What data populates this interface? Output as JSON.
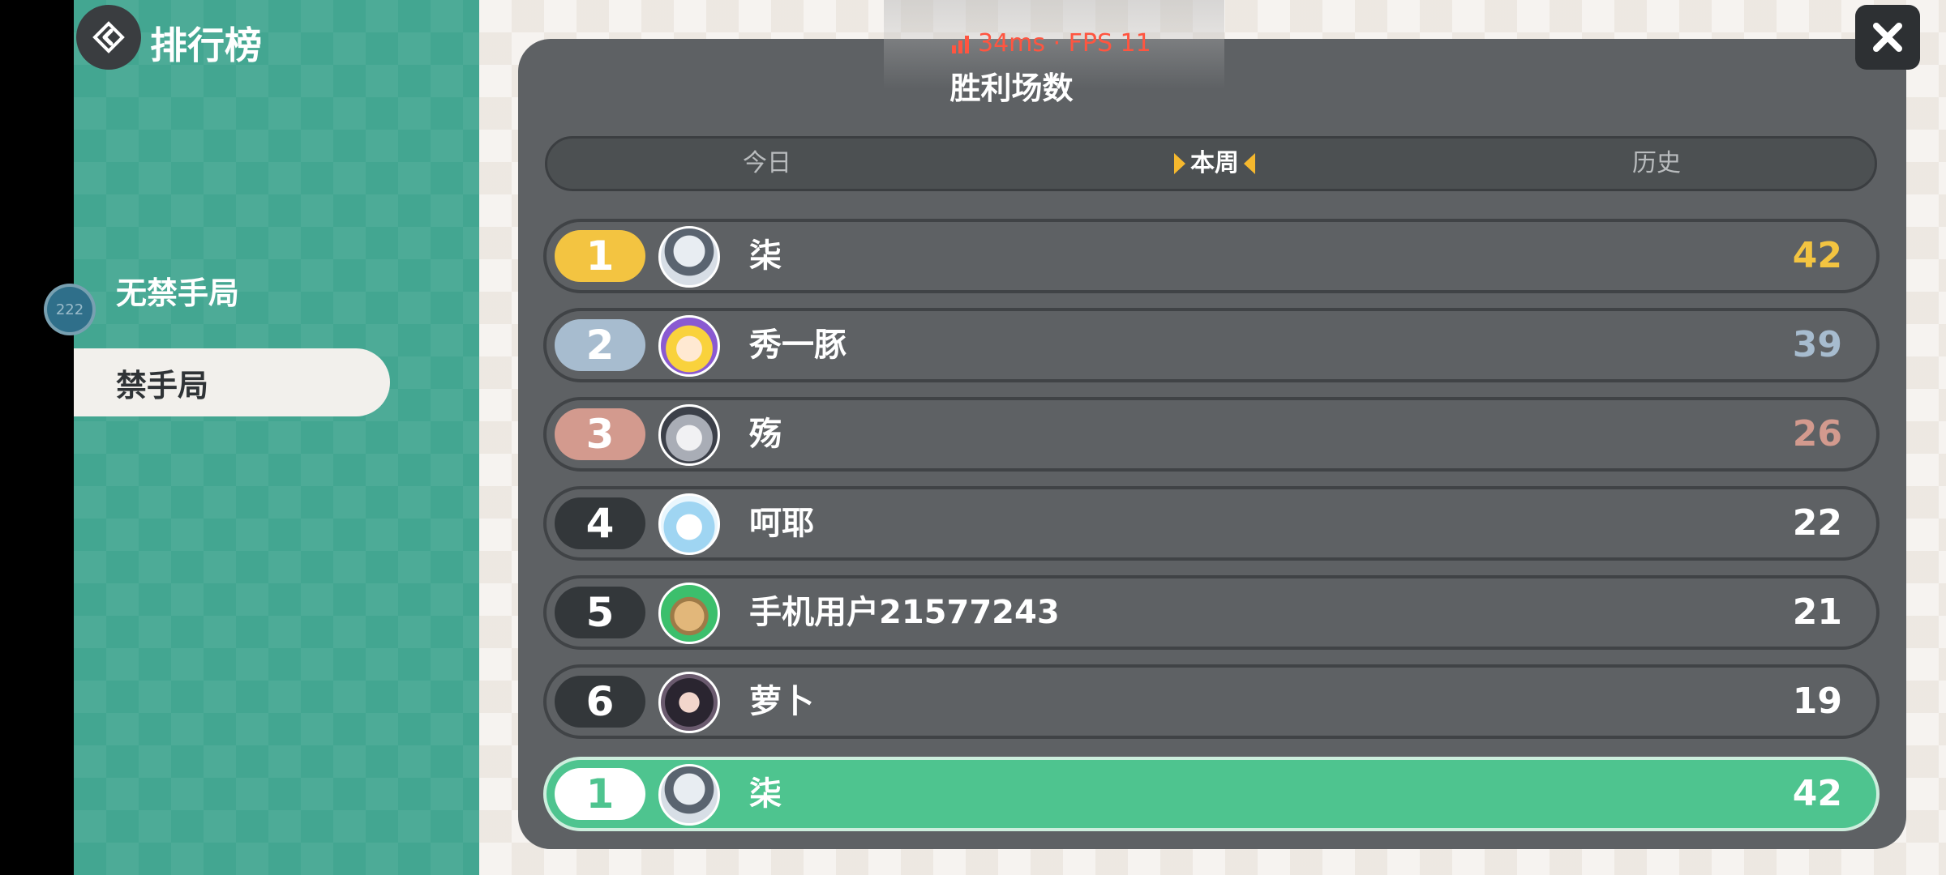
{
  "header": {
    "title": "排行榜"
  },
  "sidebar": {
    "items": [
      {
        "label": "无禁手局",
        "active": false
      },
      {
        "label": "禁手局",
        "active": true
      }
    ],
    "float_ball_label": "222"
  },
  "overlay": {
    "fps_text": "34ms · FPS 11"
  },
  "panel": {
    "title": "胜利场数",
    "tabs": [
      {
        "label": "今日",
        "active": false
      },
      {
        "label": "本周",
        "active": true
      },
      {
        "label": "历史",
        "active": false
      }
    ]
  },
  "leaderboard": [
    {
      "rank": "1",
      "name": "柒",
      "score": "42",
      "pill_color": "#f3c441",
      "score_color": "#f3c441"
    },
    {
      "rank": "2",
      "name": "秀一豚",
      "score": "39",
      "pill_color": "#a7bccf",
      "score_color": "#a7bccf"
    },
    {
      "rank": "3",
      "name": "殇",
      "score": "26",
      "pill_color": "#d39a8e",
      "score_color": "#d39a8e"
    },
    {
      "rank": "4",
      "name": "呵耶",
      "score": "22",
      "pill_color": "#33373a",
      "score_color": "#ffffff"
    },
    {
      "rank": "5",
      "name": "手机用户21577243",
      "score": "21",
      "pill_color": "#33373a",
      "score_color": "#ffffff"
    },
    {
      "rank": "6",
      "name": "萝卜",
      "score": "19",
      "pill_color": "#33373a",
      "score_color": "#ffffff"
    }
  ],
  "my_entry": {
    "rank": "1",
    "name": "柒",
    "score": "42"
  },
  "colors": {
    "sidebar": "#43a691",
    "accent_green": "#4ec48f",
    "gold": "#f3c441"
  },
  "icons": {
    "back": "back-arrow-icon",
    "close": "close-icon",
    "signal": "signal-bars-icon"
  }
}
